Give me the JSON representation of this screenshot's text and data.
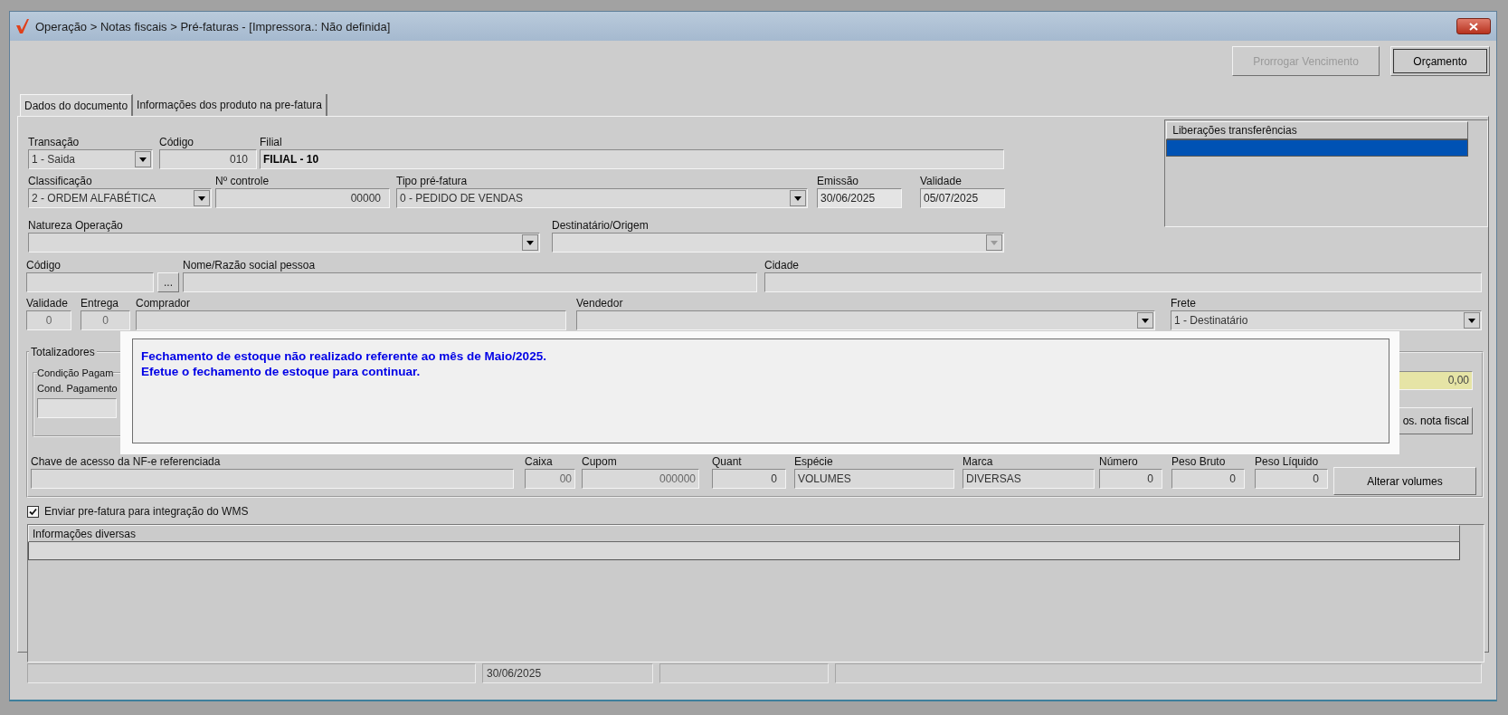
{
  "window": {
    "title": "Operação > Notas fiscais > Pré-faturas - [Impressora.: Não definida]"
  },
  "toolbar": {
    "buttons": [
      {
        "label": "Prorrogar Vencimento",
        "disabled": true
      },
      {
        "label": "Orçamento",
        "disabled": false
      }
    ]
  },
  "tabs": [
    {
      "label": "Dados do documento",
      "selected": true
    },
    {
      "label": "Informações dos produto na pre-fatura",
      "selected": false
    }
  ],
  "header_rows": [
    [
      {
        "label": "Transação",
        "value": "1 - Saida",
        "kind": "combo"
      },
      {
        "label": "Código",
        "value": "010",
        "kind": "number"
      },
      {
        "label": "Filial",
        "value": "FILIAL - 10",
        "kind": "strong"
      }
    ],
    [
      {
        "label": "Classificação",
        "value": "2 - ORDEM ALFABÉTICA",
        "kind": "combo"
      },
      {
        "label": "Nº controle",
        "value": "00000",
        "kind": "number"
      },
      {
        "label": "Tipo pré-fatura",
        "value": "0 - PEDIDO DE VENDAS",
        "kind": "combo"
      },
      {
        "label": "Emissão",
        "value": "30/06/2025",
        "kind": "date"
      },
      {
        "label": "Validade",
        "value": "05/07/2025",
        "kind": "date"
      }
    ],
    [
      {
        "label": "Natureza  Operação",
        "kind": "combo"
      },
      {
        "label": "Destinatário/Origem",
        "kind": "greyed"
      }
    ],
    [
      {
        "label": "Código",
        "kind": "text"
      },
      {
        "value": "...",
        "kind": "button"
      },
      {
        "label": "Nome/Razão social pessoa",
        "kind": "text"
      },
      {
        "label": "Cidade",
        "kind": "text"
      }
    ],
    [
      {
        "label": "Validade",
        "value": "0",
        "kind": "count"
      },
      {
        "label": "Entrega",
        "value": "0",
        "kind": "count"
      },
      {
        "label": "Comprador",
        "kind": "text"
      },
      {
        "label": "Vendedor",
        "kind": "combo"
      },
      {
        "label": "Frete",
        "value": "1 - Destinatário",
        "kind": "combo"
      }
    ]
  ],
  "liberacoes": {
    "header": "Liberações transferências",
    "rows": [
      {
        "selected": true
      }
    ]
  },
  "totalizadores": {
    "legend": "Totalizadores",
    "payment_group": {
      "legend": "Condição Pagam",
      "label": "Cond. Pagamento"
    },
    "total": "0,00",
    "button": "os. nota fiscal",
    "fields": [
      {
        "label": "Chave de acesso da NF-e referenciada",
        "kind": "text"
      },
      {
        "label": "Caixa",
        "value": "00",
        "kind": "dim"
      },
      {
        "label": "Cupom",
        "value": "000000",
        "kind": "dim"
      },
      {
        "label": "Quant",
        "value": "0",
        "kind": "number"
      },
      {
        "label": "Espécie",
        "value": "VOLUMES",
        "kind": "text"
      },
      {
        "label": "Marca",
        "value": "DIVERSAS",
        "kind": "text"
      },
      {
        "label": "Número",
        "value": "0",
        "kind": "number"
      },
      {
        "label": "Peso Bruto",
        "value": "0",
        "kind": "number"
      },
      {
        "label": "Peso Líquido",
        "value": "0",
        "kind": "number"
      }
    ],
    "volumes_button": "Alterar volumes"
  },
  "wms_checkbox": {
    "label": "Enviar pre-fatura para integração do WMS",
    "checked": true
  },
  "info_panel": {
    "header": "Informações diversas"
  },
  "status_bar": {
    "date": "30/06/2025"
  },
  "message": {
    "lines": [
      "Fechamento de estoque não realizado referente ao mês de Maio/2025.",
      "Efetue o fechamento de estoque para continuar."
    ]
  }
}
